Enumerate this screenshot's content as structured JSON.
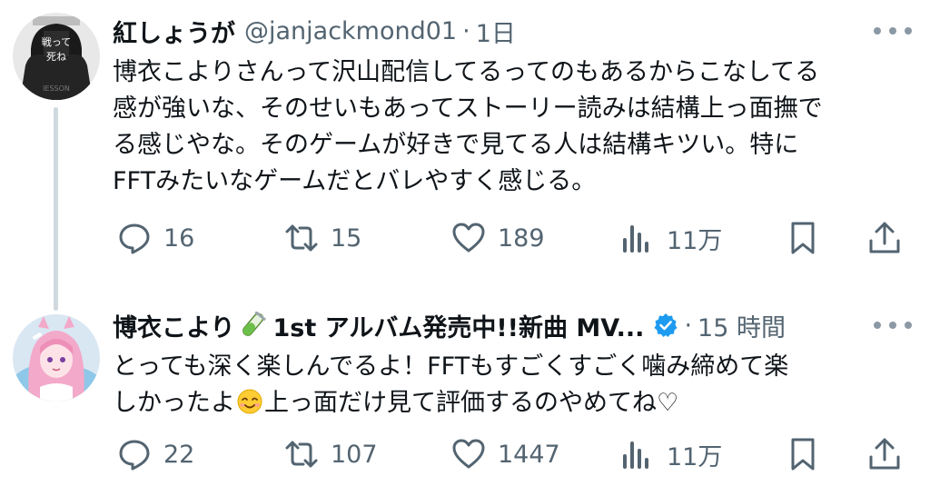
{
  "tweets": [
    {
      "author_name": "紅しょうが",
      "handle": "@janjackmond01",
      "separator": "·",
      "time": "1日",
      "avatar_icon": "dark-figure-avatar",
      "lines": [
        "博衣こよりさんって沢山配信してるってのもあるからこなしてる",
        "感が強いな、そのせいもあってストーリー読みは結構上っ面撫で",
        "る感じやな。そのゲームが好きで見てる人は結構キツい。特に",
        "FFTみたいなゲームだとバレやすく感じる。"
      ],
      "replies": "16",
      "retweets": "15",
      "likes": "189",
      "views": "11万"
    },
    {
      "author_name": "博衣こより",
      "name_suffix": "1st アルバム発売中!!新曲 MV...",
      "name_emoji": "test-tube-emoji",
      "verified_icon": "verified-badge-icon",
      "separator": "·",
      "time": "15 時間",
      "avatar_icon": "pink-anime-avatar",
      "lines": [
        "とっても深く楽しんでるよ！FFTもすごくすごく噛み締めて楽",
        "しかったよ",
        "上っ面だけ見て評価するのやめてね♡"
      ],
      "inline_emoji": "smiling-face-emoji",
      "replies": "22",
      "retweets": "107",
      "likes": "1447",
      "views": "11万"
    }
  ],
  "colors": {
    "text": "#0f1419",
    "secondary": "#536471",
    "verified": "#1d9bf0",
    "thread_line": "#cfd9de"
  }
}
